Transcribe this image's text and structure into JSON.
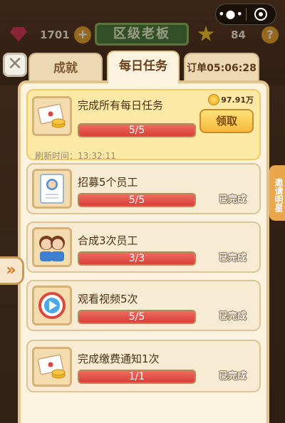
{
  "hud": {
    "gems": "1701",
    "rank": "区级老板",
    "stars": "84",
    "help": "?"
  },
  "side": {
    "right_label": "邀请明星"
  },
  "tabs": {
    "achievements": "成就",
    "daily": "每日任务",
    "order": "订单05:06:28"
  },
  "tasks": [
    {
      "title": "完成所有每日任务",
      "progress": "5/5",
      "percent": 100,
      "reward": "97.91万",
      "claim": "领取",
      "refresh": "刷新时间：13:32:11"
    },
    {
      "title": "招募5个员工",
      "progress": "5/5",
      "percent": 100,
      "status": "已完成"
    },
    {
      "title": "合成3次员工",
      "progress": "3/3",
      "percent": 100,
      "status": "已完成"
    },
    {
      "title": "观看视频5次",
      "progress": "5/5",
      "percent": 100,
      "status": "已完成"
    },
    {
      "title": "完成缴费通知1次",
      "progress": "1/1",
      "percent": 100,
      "status": "已完成"
    }
  ],
  "colors": {
    "panel": "#fbf3df",
    "accent": "#e2c48b",
    "bar_fill": "#e14a40",
    "highlight": "#fde9a6"
  },
  "icons": [
    "close-icon",
    "more-icon",
    "mini-program-close-icon",
    "gem-icon",
    "plus-icon",
    "star-icon",
    "help-icon",
    "expand-arrow-icon",
    "envelope-coins-icon",
    "employee-card-icon",
    "employees-pair-icon",
    "play-video-icon"
  ]
}
